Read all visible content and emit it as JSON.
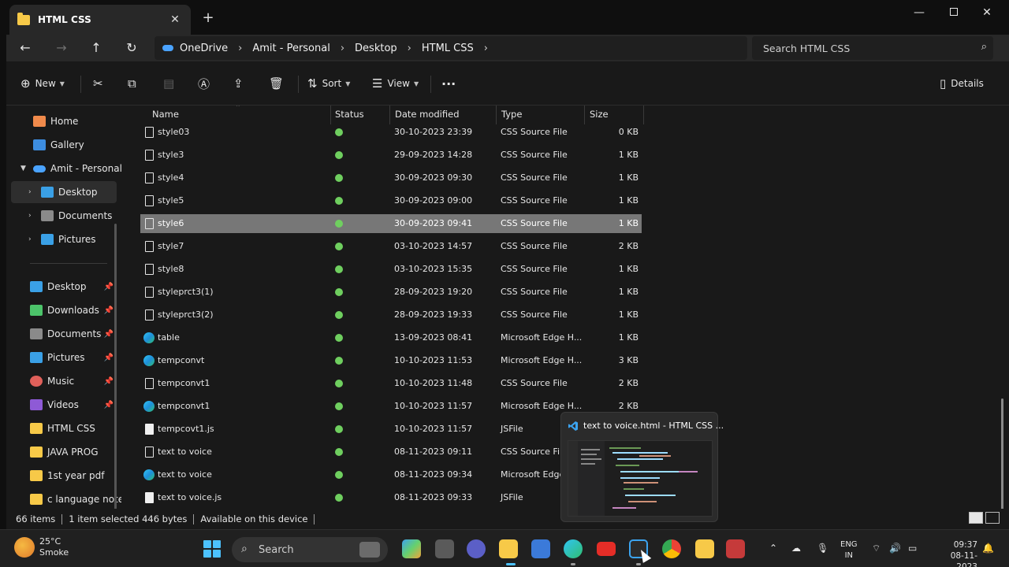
{
  "window": {
    "tab_title": "HTML CSS",
    "tab_close": "✕",
    "new_tab": "+",
    "controls": {
      "minimize": "—",
      "close": "✕"
    }
  },
  "address": {
    "crumbs": [
      "OneDrive",
      "Amit - Personal",
      "Desktop",
      "HTML CSS"
    ],
    "separator": "›",
    "search_placeholder": "Search HTML CSS"
  },
  "toolbar": {
    "new_label": "New",
    "sort_label": "Sort",
    "view_label": "View",
    "more_label": "···",
    "details_label": "Details"
  },
  "sidebar": {
    "items": [
      {
        "label": "Home",
        "icon": "home-icon",
        "color": "#f08a4b"
      },
      {
        "label": "Gallery",
        "icon": "gallery-icon",
        "color": "#3d8de0"
      },
      {
        "label": "Amit - Personal",
        "icon": "onedrive-icon",
        "color": "#4aa3ff"
      },
      {
        "label": "Desktop",
        "icon": "desktop-icon",
        "color": "#3aa0e6"
      },
      {
        "label": "Documents",
        "icon": "documents-icon",
        "color": "#8a8a8a"
      },
      {
        "label": "Pictures",
        "icon": "pictures-icon",
        "color": "#3aa0e6"
      }
    ],
    "quick_access": [
      {
        "label": "Desktop",
        "icon": "desktop-icon",
        "color": "#3aa0e6",
        "pinned": true
      },
      {
        "label": "Downloads",
        "icon": "downloads-icon",
        "color": "#4cc46a",
        "pinned": true
      },
      {
        "label": "Documents",
        "icon": "documents-icon",
        "color": "#8a8a8a",
        "pinned": true
      },
      {
        "label": "Pictures",
        "icon": "pictures-icon",
        "color": "#3aa0e6",
        "pinned": true
      },
      {
        "label": "Music",
        "icon": "music-icon",
        "color": "#e0605a",
        "pinned": true
      },
      {
        "label": "Videos",
        "icon": "videos-icon",
        "color": "#8e5ad6",
        "pinned": true
      },
      {
        "label": "HTML CSS",
        "icon": "folder-icon",
        "color": "#f7c948",
        "pinned": false
      },
      {
        "label": "JAVA PROG",
        "icon": "folder-icon",
        "color": "#f7c948",
        "pinned": false
      },
      {
        "label": "1st year pdf",
        "icon": "folder-icon",
        "color": "#f7c948",
        "pinned": false
      },
      {
        "label": "c language note",
        "icon": "folder-icon",
        "color": "#f7c948",
        "pinned": false
      }
    ],
    "pin_glyph": "📌"
  },
  "columns": {
    "name": "Name",
    "status": "Status",
    "date": "Date modified",
    "type": "Type",
    "size": "Size"
  },
  "files": [
    {
      "name": "style03",
      "date": "30-10-2023 23:39",
      "type": "CSS Source File",
      "size": "0 KB",
      "kind": "css"
    },
    {
      "name": "style3",
      "date": "29-09-2023 14:28",
      "type": "CSS Source File",
      "size": "1 KB",
      "kind": "css"
    },
    {
      "name": "style4",
      "date": "30-09-2023 09:30",
      "type": "CSS Source File",
      "size": "1 KB",
      "kind": "css"
    },
    {
      "name": "style5",
      "date": "30-09-2023 09:00",
      "type": "CSS Source File",
      "size": "1 KB",
      "kind": "css"
    },
    {
      "name": "style6",
      "date": "30-09-2023 09:41",
      "type": "CSS Source File",
      "size": "1 KB",
      "kind": "css",
      "selected": true
    },
    {
      "name": "style7",
      "date": "03-10-2023 14:57",
      "type": "CSS Source File",
      "size": "2 KB",
      "kind": "css"
    },
    {
      "name": "style8",
      "date": "03-10-2023 15:35",
      "type": "CSS Source File",
      "size": "1 KB",
      "kind": "css"
    },
    {
      "name": "styleprct3(1)",
      "date": "28-09-2023 19:20",
      "type": "CSS Source File",
      "size": "1 KB",
      "kind": "css"
    },
    {
      "name": "styleprct3(2)",
      "date": "28-09-2023 19:33",
      "type": "CSS Source File",
      "size": "1 KB",
      "kind": "css"
    },
    {
      "name": "table",
      "date": "13-09-2023 08:41",
      "type": "Microsoft Edge H...",
      "size": "1 KB",
      "kind": "edge"
    },
    {
      "name": "tempconvt",
      "date": "10-10-2023 11:53",
      "type": "Microsoft Edge H...",
      "size": "3 KB",
      "kind": "edge"
    },
    {
      "name": "tempconvt1",
      "date": "10-10-2023 11:48",
      "type": "CSS Source File",
      "size": "2 KB",
      "kind": "css"
    },
    {
      "name": "tempconvt1",
      "date": "10-10-2023 11:57",
      "type": "Microsoft Edge H...",
      "size": "2 KB",
      "kind": "edge"
    },
    {
      "name": "tempcovt1.js",
      "date": "10-10-2023 11:57",
      "type": "JSFile",
      "size": "",
      "kind": "js"
    },
    {
      "name": "text to voice",
      "date": "08-11-2023 09:11",
      "type": "CSS Source File",
      "size": "",
      "kind": "css"
    },
    {
      "name": "text to voice",
      "date": "08-11-2023 09:34",
      "type": "Microsoft Edge H",
      "size": "",
      "kind": "edge"
    },
    {
      "name": "text to voice.js",
      "date": "08-11-2023 09:33",
      "type": "JSFile",
      "size": "",
      "kind": "js"
    }
  ],
  "status": {
    "count": "66 items",
    "selected": "1 item selected 446 bytes",
    "availability": "Available on this device"
  },
  "preview": {
    "title": "text to voice.html - HTML CSS ..."
  },
  "taskbar": {
    "weather_temp": "25°C",
    "weather_desc": "Smoke",
    "search_placeholder": "Search",
    "lang_top": "ENG",
    "lang_bottom": "IN",
    "time": "09:37",
    "date": "08-11-2023"
  },
  "colors": {
    "accent": "#4cc2ff",
    "selected_row": "#777777",
    "status_ok": "#6fcf5f",
    "folder": "#f7c948"
  }
}
